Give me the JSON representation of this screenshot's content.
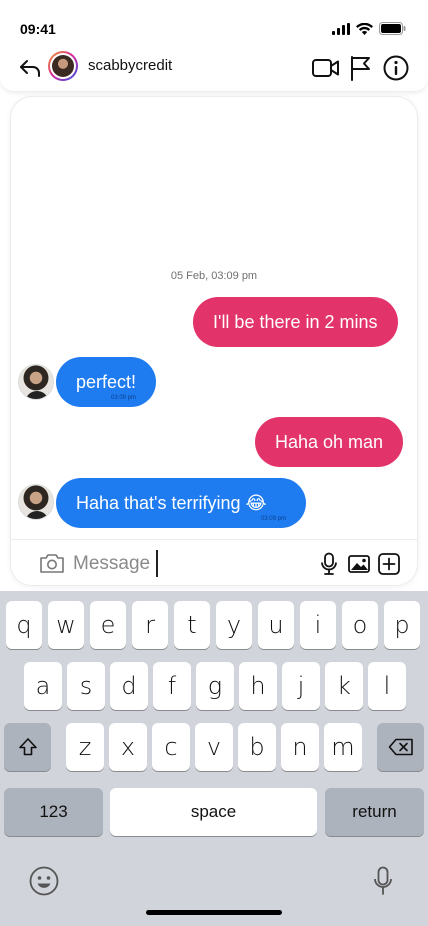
{
  "status_bar": {
    "time": "09:41"
  },
  "header": {
    "username": "scabbycredit"
  },
  "chat": {
    "date_label": "05 Feb, 03:09 pm",
    "messages": [
      {
        "direction": "out",
        "text": "I'll be there in 2 mins",
        "time": ""
      },
      {
        "direction": "in",
        "text": "perfect!",
        "time": "03:09 pm"
      },
      {
        "direction": "out",
        "text": "Haha oh man",
        "time": ""
      },
      {
        "direction": "in",
        "text": "Haha that's terrifying 😂",
        "time": "03:09 pm"
      }
    ]
  },
  "composer": {
    "placeholder": "Message",
    "value": ""
  },
  "keyboard": {
    "row1": [
      "q",
      "w",
      "e",
      "r",
      "t",
      "y",
      "u",
      "i",
      "o",
      "p"
    ],
    "row2": [
      "a",
      "s",
      "d",
      "f",
      "g",
      "h",
      "j",
      "k",
      "l"
    ],
    "row3": [
      "z",
      "x",
      "c",
      "v",
      "b",
      "n",
      "m"
    ],
    "numbers_label": "123",
    "space_label": "space",
    "return_label": "return"
  },
  "colors": {
    "outgoing_bubble": "#e2336b",
    "incoming_bubble": "#1f7cf0",
    "keyboard_bg": "#d1d4da"
  },
  "icons": [
    "signal-icon",
    "wifi-icon",
    "battery-icon",
    "back-arrow-icon",
    "video-call-icon",
    "flag-icon",
    "info-icon",
    "camera-icon",
    "microphone-icon",
    "image-icon",
    "add-icon",
    "shift-icon",
    "backspace-icon",
    "emoji-icon",
    "dictation-mic-icon"
  ]
}
